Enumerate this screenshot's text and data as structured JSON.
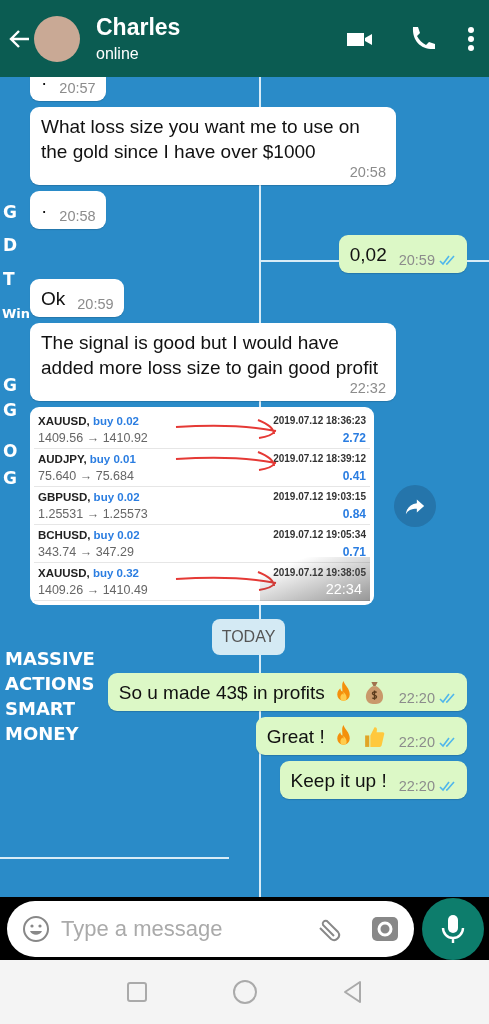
{
  "header": {
    "name": "Charles",
    "status": "online"
  },
  "wallpaper": {
    "letters": [
      "G",
      "D",
      "T",
      "Win",
      "G",
      "G",
      "O",
      "G"
    ],
    "slogan": [
      "MASSIVE",
      "ACTIONS",
      "SMART",
      "MONEY"
    ]
  },
  "messages": [
    {
      "kind": "text",
      "outgoing": false,
      "text": "·",
      "time": "20:57"
    },
    {
      "kind": "text",
      "outgoing": false,
      "text": "What loss size you want me to use on the gold  since I have over $1000",
      "time": "20:58"
    },
    {
      "kind": "text",
      "outgoing": false,
      "text": "·",
      "time": "20:58"
    },
    {
      "kind": "text",
      "outgoing": true,
      "text": "0,02",
      "time": "20:59",
      "read": true
    },
    {
      "kind": "text",
      "outgoing": false,
      "text": "Ok",
      "time": "20:59"
    },
    {
      "kind": "text",
      "outgoing": false,
      "text": "The signal is good but I would have added more loss size to gain good profit",
      "time": "22:32"
    },
    {
      "kind": "trades",
      "time": "22:34",
      "trades": [
        {
          "symbol": "XAUUSD,",
          "order": "buy 0.02",
          "prices": "1409.56 → 1410.92",
          "date": "2019.07.12 18:36:23",
          "profit": "2.72",
          "scribble": true
        },
        {
          "symbol": "AUDJPY,",
          "order": "buy 0.01",
          "prices": "75.640 → 75.684",
          "date": "2019.07.12 18:39:12",
          "profit": "0.41",
          "scribble": true
        },
        {
          "symbol": "GBPUSD,",
          "order": "buy 0.02",
          "prices": "1.25531 → 1.25573",
          "date": "2019.07.12 19:03:15",
          "profit": "0.84",
          "scribble": false
        },
        {
          "symbol": "BCHUSD,",
          "order": "buy 0.02",
          "prices": "343.74 → 347.29",
          "date": "2019.07.12 19:05:34",
          "profit": "0.71",
          "scribble": false
        },
        {
          "symbol": "XAUUSD,",
          "order": "buy 0.32",
          "prices": "1409.26 → 1410.49",
          "date": "2019.07.12 19:38:05",
          "scribble": true
        }
      ]
    },
    {
      "kind": "date",
      "text": "TODAY"
    },
    {
      "kind": "text",
      "outgoing": true,
      "text": "So u made 43$ in profits",
      "emoji": [
        {
          "kind": "fire"
        },
        {
          "kind": "money_bag"
        }
      ],
      "time": "22:20",
      "read": true
    },
    {
      "kind": "text",
      "outgoing": true,
      "text": "Great !",
      "emoji": [
        {
          "kind": "fire"
        },
        {
          "kind": "thumbs_up"
        }
      ],
      "time": "22:20",
      "read": true
    },
    {
      "kind": "text",
      "outgoing": true,
      "text": "Keep it up !",
      "time": "22:20",
      "read": true
    }
  ],
  "composer": {
    "placeholder": "Type a message"
  }
}
